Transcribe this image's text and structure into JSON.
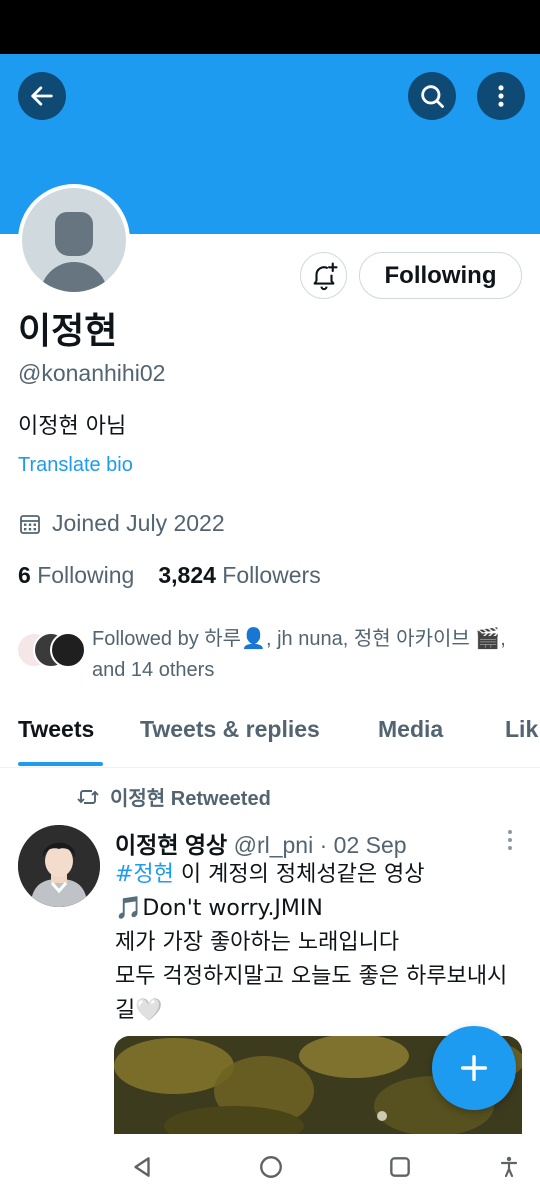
{
  "profile": {
    "display_name": "이정현",
    "handle": "@konanhihi02",
    "bio": "이정현 아님",
    "translate_label": "Translate bio",
    "joined": "Joined July 2022",
    "following_count": "6",
    "following_label": "Following",
    "followers_count": "3,824",
    "followers_label": "Followers",
    "followed_by": "Followed by 하루👤, jh nuna, 정현 아카이브 🎬, and 14 others",
    "follow_button_label": "Following"
  },
  "tabs": [
    {
      "label": "Tweets",
      "active": true
    },
    {
      "label": "Tweets & replies",
      "active": false
    },
    {
      "label": "Media",
      "active": false
    },
    {
      "label": "Lik",
      "active": false
    }
  ],
  "tweet": {
    "retweet_user": "이정현",
    "retweet_label": "Retweeted",
    "author_name": "이정현 영상",
    "author_handle": "@rl_pni",
    "separator": "·",
    "date": "02 Sep",
    "hashtag": "#정현",
    "line1_rest": " 이 계정의 정체성같은 영상",
    "line2": "🎵Don't worry.JMIN",
    "line3": "제가 가장 좋아하는 노래입니다",
    "line4": "모두 걱정하지말고 오늘도 좋은 하루보내시길🤍"
  },
  "colors": {
    "banner": "#1d9bf0",
    "accent": "#1d9bf0",
    "secondary_text": "#536471",
    "primary_text": "#0f1419"
  },
  "icons": {
    "back": "arrow-left-icon",
    "search": "search-icon",
    "more": "more-vertical-icon",
    "bell": "bell-plus-icon",
    "calendar": "calendar-icon",
    "retweet": "retweet-icon",
    "compose": "plus-icon",
    "nav_back": "triangle-back-icon",
    "nav_home": "circle-home-icon",
    "nav_recents": "square-recents-icon",
    "nav_accessibility": "accessibility-icon"
  }
}
